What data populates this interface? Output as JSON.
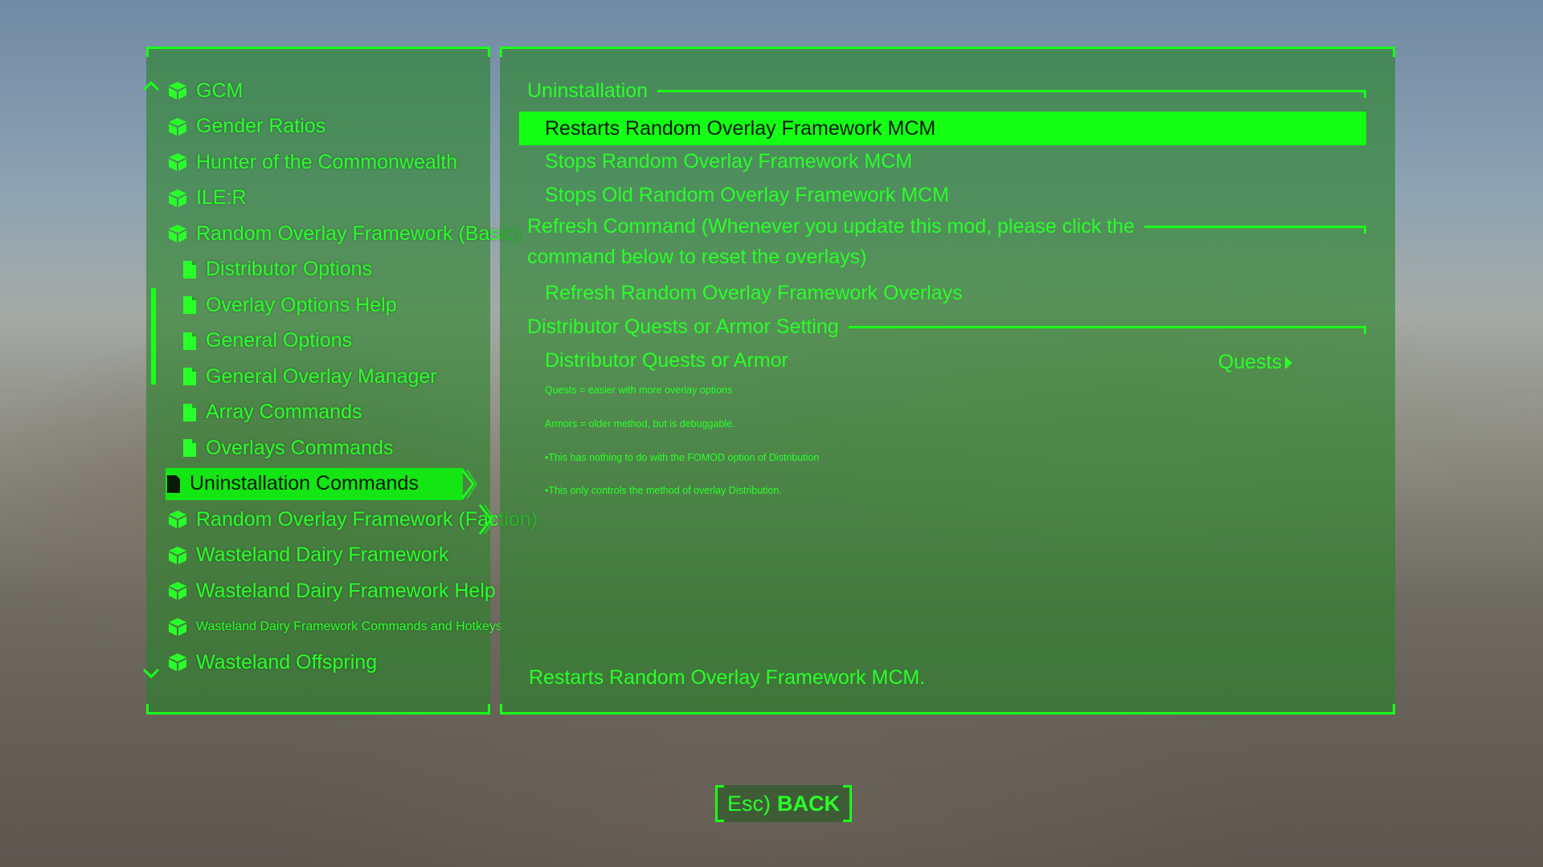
{
  "nav": {
    "items": [
      {
        "label": "GCM",
        "type": "mod"
      },
      {
        "label": "Gender Ratios",
        "type": "mod"
      },
      {
        "label": "Hunter of the Commonwealth",
        "type": "mod"
      },
      {
        "label": "ILE:R",
        "type": "mod"
      },
      {
        "label": "Random Overlay Framework (Basic)",
        "type": "mod"
      },
      {
        "label": "Distributor Options",
        "type": "page"
      },
      {
        "label": "Overlay Options Help",
        "type": "page"
      },
      {
        "label": "General Options",
        "type": "page"
      },
      {
        "label": "General Overlay Manager",
        "type": "page"
      },
      {
        "label": "Array Commands",
        "type": "page"
      },
      {
        "label": "Overlays Commands",
        "type": "page"
      },
      {
        "label": "Uninstallation Commands",
        "type": "page",
        "selected": true
      },
      {
        "label": "Random Overlay Framework (Faction)",
        "type": "mod"
      },
      {
        "label": "Wasteland Dairy Framework",
        "type": "mod"
      },
      {
        "label": "Wasteland Dairy Framework Help",
        "type": "mod"
      },
      {
        "label": "Wasteland Dairy Framework Commands and Hotkeys",
        "type": "mod"
      },
      {
        "label": "Wasteland Offspring",
        "type": "mod"
      }
    ],
    "icons": {
      "mod": "cube-icon",
      "page": "document-icon"
    }
  },
  "content": {
    "uninstall_header": "Uninstallation",
    "restart_option": "Restarts Random Overlay Framework MCM",
    "stop_option": "Stops Random Overlay Framework MCM",
    "stop_old_option": "Stops Old Random Overlay Framework MCM",
    "refresh_header_line1": "Refresh Command (Whenever you update this mod, please click the",
    "refresh_header_line2": "command below to reset the overlays)",
    "refresh_option": "Refresh Random Overlay Framework Overlays",
    "distributor_header": "Distributor Quests or Armor Setting",
    "distributor_option": "Distributor Quests or Armor",
    "distributor_value": "Quests",
    "note1": "Quests = easier with more overlay options",
    "note2": "Armors = older method, but is debuggable.",
    "note3": "•This has nothing to do with the FOMOD option of Distribution",
    "note4": "•This only controls the method of overlay Distribution.",
    "description": "Restarts Random Overlay Framework MCM."
  },
  "footer": {
    "back_key": "Esc)",
    "back_label": "BACK"
  },
  "colors": {
    "accent": "#1aff1a",
    "panel": "#2b822b",
    "highlight_text": "#0a1a0a"
  }
}
